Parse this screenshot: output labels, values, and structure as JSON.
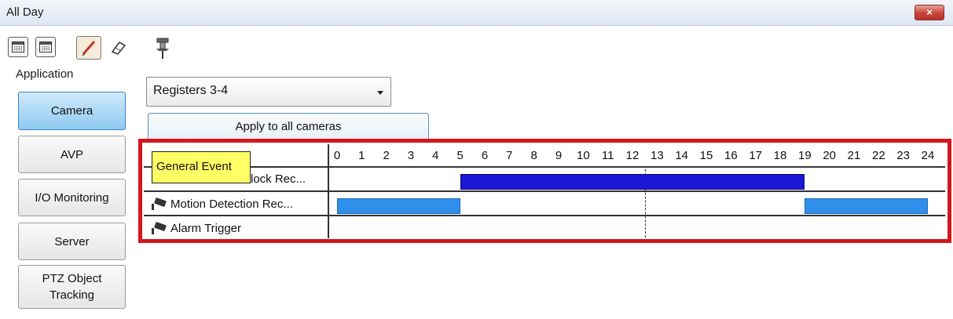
{
  "window": {
    "title": "All Day",
    "close_label": "×"
  },
  "toolbar": {
    "icons": [
      "calendar-icon",
      "calendar-alt-icon",
      "pencil-icon",
      "eraser-icon",
      "pin-icon"
    ]
  },
  "sidebar": {
    "label": "Application",
    "items": [
      {
        "label": "Camera",
        "active": true
      },
      {
        "label": "AVP",
        "active": false
      },
      {
        "label": "I/O Monitoring",
        "active": false
      },
      {
        "label": "Server",
        "active": false
      },
      {
        "label": "PTZ Object\nTracking",
        "active": false
      }
    ]
  },
  "main": {
    "register_select": "Registers 3-4",
    "apply_button": "Apply to all cameras",
    "schedule": {
      "hours": [
        "0",
        "1",
        "2",
        "3",
        "4",
        "5",
        "6",
        "7",
        "8",
        "9",
        "10",
        "11",
        "12",
        "13",
        "14",
        "15",
        "16",
        "17",
        "18",
        "19",
        "20",
        "21",
        "22",
        "23",
        "24"
      ],
      "rows": [
        {
          "label": "Block Rec...",
          "bars": [
            {
              "start": 5,
              "end": 19,
              "color": "#1a17d9"
            }
          ]
        },
        {
          "label": "Motion Detection Rec...",
          "bars": [
            {
              "start": 0,
              "end": 5,
              "color": "#2f8fea"
            },
            {
              "start": 19,
              "end": 24,
              "color": "#2f8fea"
            }
          ]
        },
        {
          "label": "Alarm Trigger",
          "bars": []
        }
      ],
      "tooltip": "General Event"
    }
  },
  "colors": {
    "highlight_frame": "#d4161d",
    "tooltip_bg": "#ffff66"
  }
}
